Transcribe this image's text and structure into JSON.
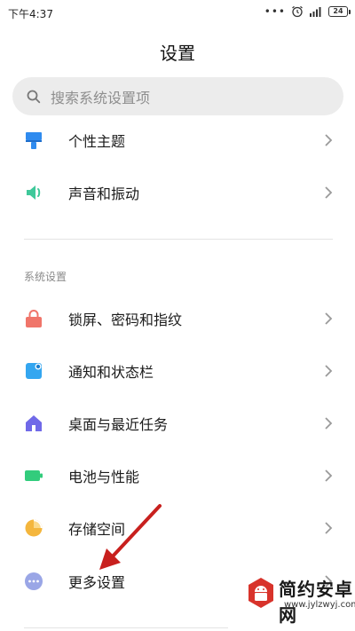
{
  "status_bar": {
    "time": "下午4:37",
    "dots": "•••",
    "battery": "24"
  },
  "header": {
    "title": "设置"
  },
  "search": {
    "placeholder": "搜索系统设置项"
  },
  "top_items": [
    {
      "label": "个性主题",
      "icon": "paint-roller-icon",
      "color": "#2f8bef"
    },
    {
      "label": "声音和振动",
      "icon": "speaker-icon",
      "color": "#3fc89a"
    }
  ],
  "section": {
    "header": "系统设置"
  },
  "system_items": [
    {
      "label": "锁屏、密码和指纹",
      "icon": "lock-icon",
      "color": "#f0756a"
    },
    {
      "label": "通知和状态栏",
      "icon": "notification-icon",
      "color": "#34a6f0"
    },
    {
      "label": "桌面与最近任务",
      "icon": "home-icon",
      "color": "#7069e8"
    },
    {
      "label": "电池与性能",
      "icon": "battery-icon",
      "color": "#32cc7c"
    },
    {
      "label": "存储空间",
      "icon": "pie-chart-icon",
      "color": "#f4b63d"
    },
    {
      "label": "更多设置",
      "icon": "more-dots-icon",
      "color": "#9aa6e6"
    }
  ],
  "watermark": {
    "name": "简约安卓网",
    "url": "www.jylzwyj.com"
  },
  "accent_colors": {
    "annotation_arrow": "#c8201e",
    "chevron": "#9a9a9a"
  }
}
